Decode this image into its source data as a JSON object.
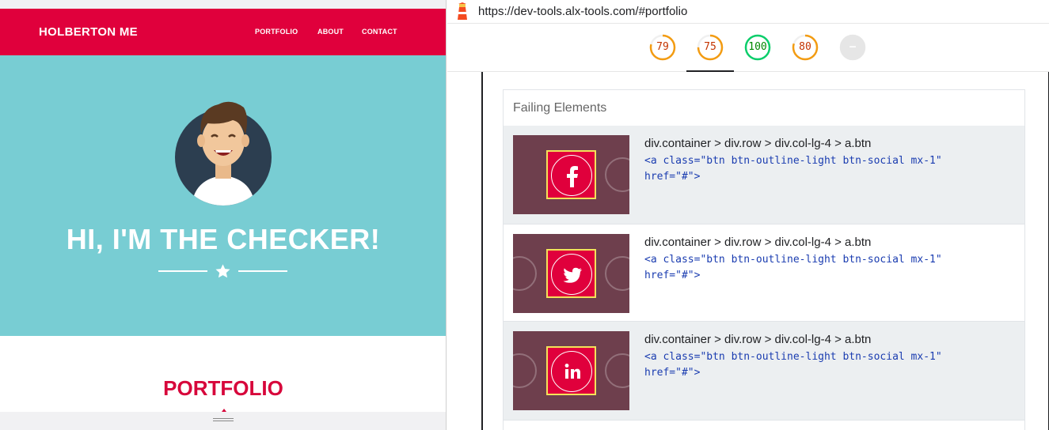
{
  "site": {
    "brand": "HOLBERTON ME",
    "nav": [
      "PORTFOLIO",
      "ABOUT",
      "CONTACT"
    ],
    "hero_title": "HI, I'M THE CHECKER!",
    "section_title": "PORTFOLIO",
    "colors": {
      "primary": "#e0003c",
      "hero_bg": "#78cdd3"
    }
  },
  "browser": {
    "url": "https://dev-tools.alx-tools.com/#portfolio"
  },
  "lighthouse": {
    "scores": [
      {
        "label": "79",
        "value": 79,
        "color": "#f39c12"
      },
      {
        "label": "75",
        "value": 75,
        "color": "#f39c12"
      },
      {
        "label": "100",
        "value": 100,
        "color": "#0cce6b"
      },
      {
        "label": "80",
        "value": 80,
        "color": "#f39c12"
      },
      {
        "label": "–",
        "value": 0,
        "color": "#c8c8c8"
      }
    ],
    "failing_title": "Failing Elements",
    "failing": [
      {
        "selector": "div.container > div.row > div.col-lg-4 > a.btn",
        "snippet": "<a class=\"btn btn-outline-light btn-social mx-1\"\nhref=\"#\">",
        "icon": "facebook-icon"
      },
      {
        "selector": "div.container > div.row > div.col-lg-4 > a.btn",
        "snippet": "<a class=\"btn btn-outline-light btn-social mx-1\"\nhref=\"#\">",
        "icon": "twitter-icon"
      },
      {
        "selector": "div.container > div.row > div.col-lg-4 > a.btn",
        "snippet": "<a class=\"btn btn-outline-light btn-social mx-1\"\nhref=\"#\">",
        "icon": "linkedin-icon"
      }
    ]
  }
}
